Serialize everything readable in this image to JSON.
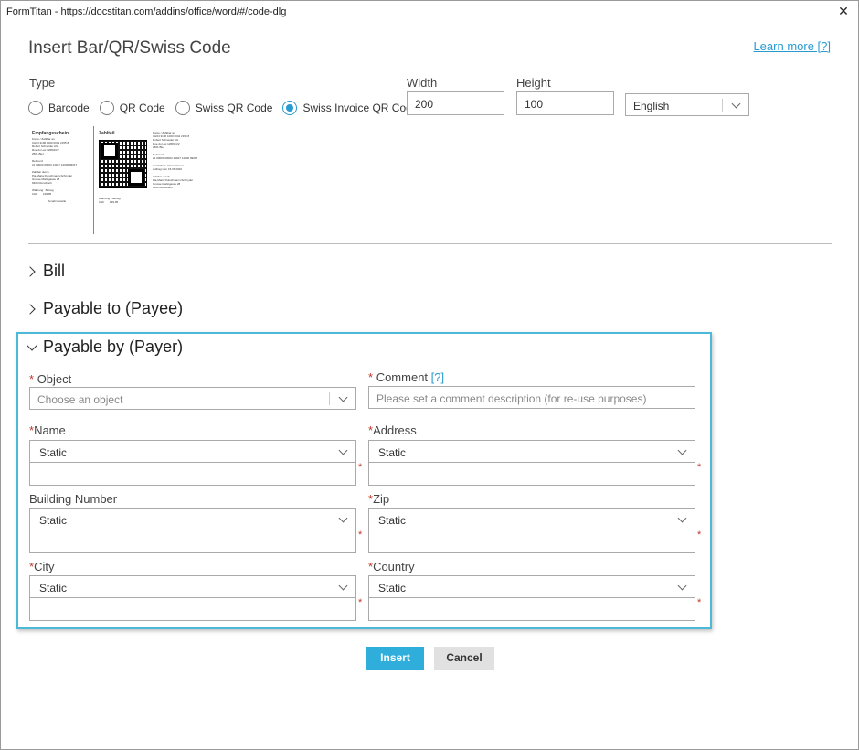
{
  "window": {
    "title": "FormTitan - https://docstitan.com/addins/office/word/#/code-dlg",
    "close_glyph": "✕"
  },
  "dialog": {
    "heading": "Insert Bar/QR/Swiss Code",
    "learn_more": "Learn more [?]"
  },
  "type": {
    "label": "Type",
    "options": [
      "Barcode",
      "QR Code",
      "Swiss QR Code",
      "Swiss Invoice QR Code"
    ],
    "selected": "Swiss Invoice QR Code"
  },
  "dimensions": {
    "width_label": "Width",
    "width_value": "200",
    "height_label": "Height",
    "height_value": "100",
    "language": "English"
  },
  "preview": {
    "receipt_title": "Empfangsschein",
    "payment_title": "Zahlteil",
    "receipt_lines": "Konto / Zahlbar an\nCH64 3196 1000 0044 2155 8\nRobert Schneider AG\nRue du Lac 1268/2/22\n2501 Biel\n\nReferenz\n21 00000 00003 13947 14300 09017\n\nZahlbar durch\nPia-Maria Rutschmann-Schnyder\nGrosse Marktgasse 28\n9400 Rorschach\n\nWährung   Betrag\nCHF       199.95\n\n                     Annahmestelle",
    "payment_lines": "Konto / Zahlbar an\nCH64 3196 1000 0044 2155 8\nRobert Schneider AG\nRue du Lac 1268/2/22\n2501 Biel\n\nReferenz\n21 00000 00003 13947 14300 09017\n\nZusätzliche Informationen\nAuftrag vom 15.06.2020\n\nZahlbar durch\nPia-Maria Rutschmann-Schnyder\nGrosse Marktgasse 28\n9400 Rorschach",
    "payment_amount": "Währung   Betrag\nCHF       199.95"
  },
  "sections": {
    "bill": "Bill",
    "payee": "Payable to (Payee)",
    "payer": "Payable by (Payer)"
  },
  "payer_form": {
    "required_mark": "*",
    "object_label": "Object",
    "object_placeholder": "Choose an object",
    "comment_label": "Comment",
    "comment_help": "[?]",
    "comment_placeholder": "Please set a comment description (for re-use purposes)",
    "name_label": "Name",
    "address_label": "Address",
    "building_label": "Building Number",
    "zip_label": "Zip",
    "city_label": "City",
    "country_label": "Country",
    "static_option": "Static"
  },
  "buttons": {
    "insert": "Insert",
    "cancel": "Cancel"
  }
}
